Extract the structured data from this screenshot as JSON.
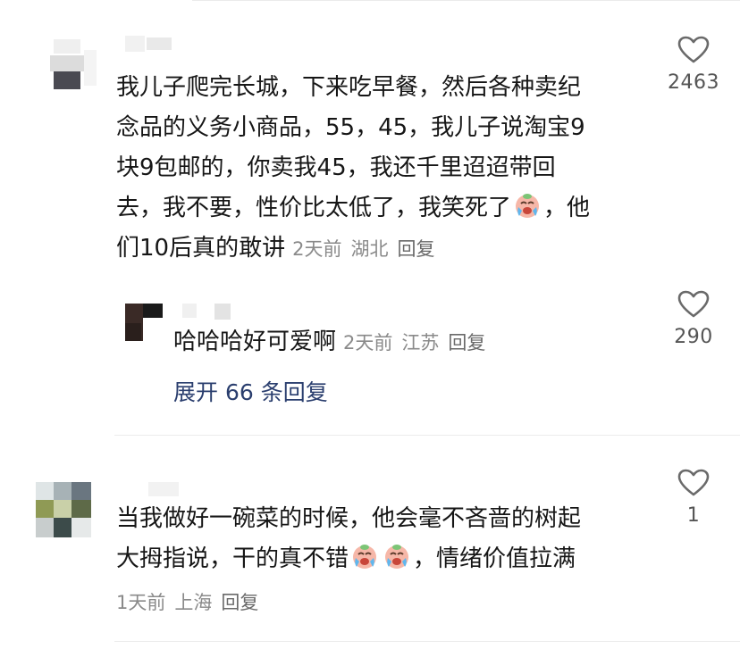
{
  "comments": [
    {
      "text_lines": [
        "我儿子爬完长城，下来吃早餐，然后各种卖纪",
        "念品的义务小商品，55，45，我儿子说淘宝9",
        "块9包邮的，你卖我45，我还千里迢迢带回",
        "去，我不要，性价比太低了，我笑死了",
        "们10后真的敢讲"
      ],
      "line4_tail": "，他",
      "time": "2天前",
      "location": "湖北",
      "reply_label": "回复",
      "like_count": "2463",
      "emoji_icon": "laugh-cry-emoji",
      "reply": {
        "text": "哈哈哈好可爱啊",
        "time": "2天前",
        "location": "江苏",
        "reply_label": "回复",
        "like_count": "290"
      },
      "expand_label": "展开 66 条回复"
    },
    {
      "text_lines": [
        "当我做好一碗菜的时候，他会毫不吝啬的树起",
        "大拇指说，干的真不错"
      ],
      "line2_tail": "，情绪价值拉满",
      "time": "1天前",
      "location": "上海",
      "reply_label": "回复",
      "like_count": "1",
      "emoji_icon": "laugh-cry-emoji"
    }
  ],
  "colors": {
    "text": "#161616",
    "meta": "#8a8a8a",
    "link": "#2a3e6e",
    "divider": "#ebebeb"
  }
}
